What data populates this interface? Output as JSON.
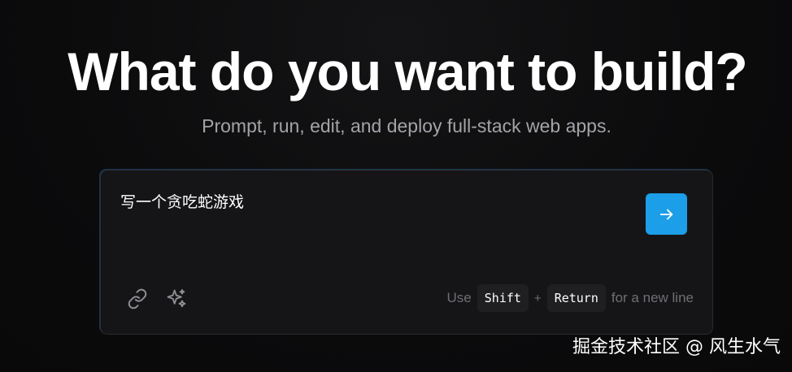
{
  "hero": {
    "title": "What do you want to build?",
    "subtitle": "Prompt, run, edit, and deploy full-stack web apps."
  },
  "prompt": {
    "value": "写一个贪吃蛇游戏",
    "send_icon": "arrow-right-icon",
    "attach_icon": "link-icon",
    "enhance_icon": "sparkles-icon",
    "hint_prefix": "Use",
    "hint_key1": "Shift",
    "hint_plus": "+",
    "hint_key2": "Return",
    "hint_suffix": "for a new line"
  },
  "colors": {
    "background": "#0b0b0c",
    "accent": "#1c9ee8",
    "box": "#151517"
  },
  "watermark": {
    "text": "掘金技术社区 @ 风生水气"
  }
}
